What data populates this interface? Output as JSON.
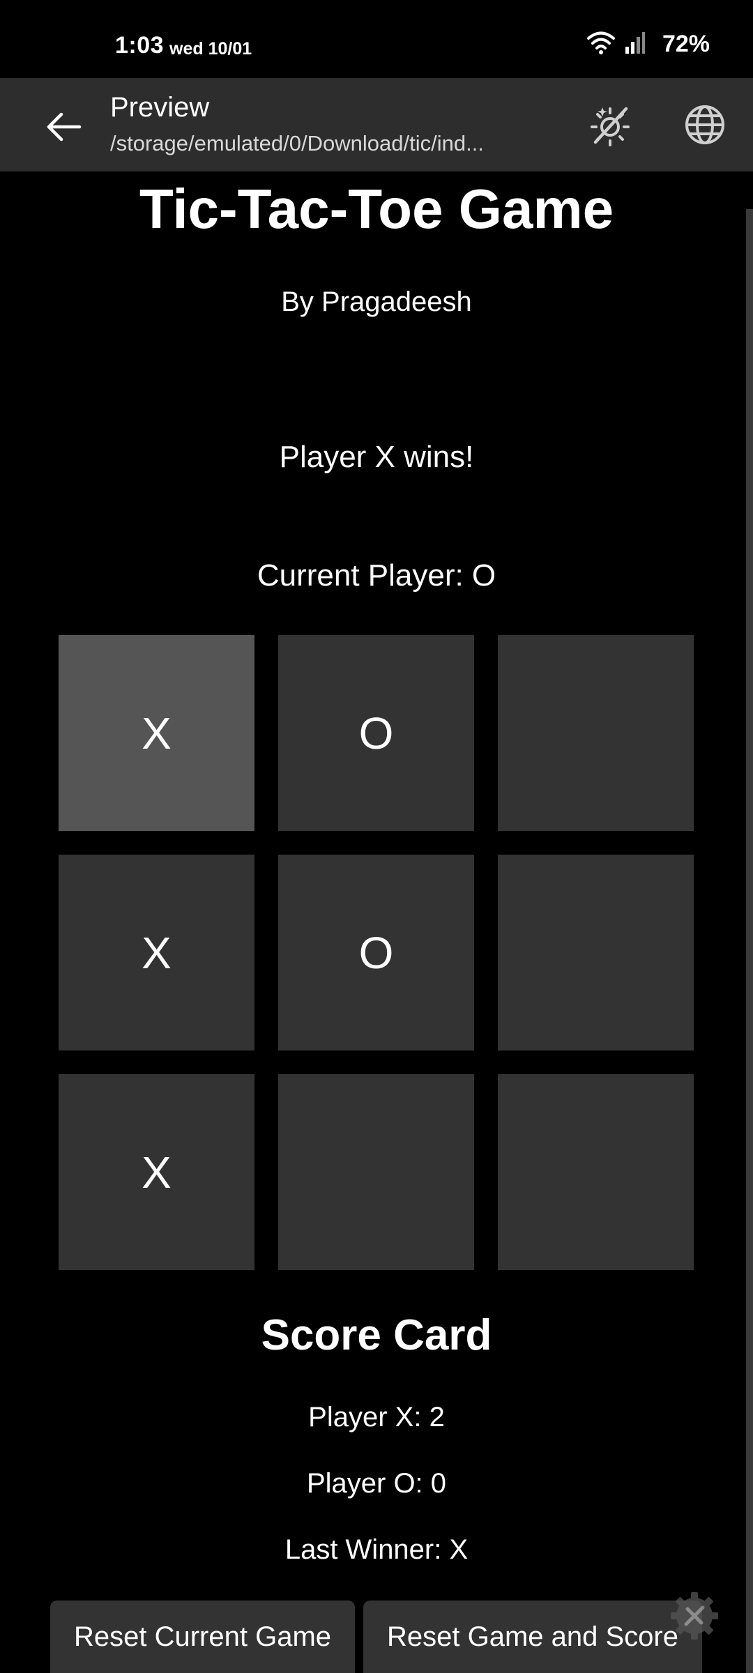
{
  "status_bar": {
    "time": "1:03",
    "date": "wed 10/01",
    "battery": "72%"
  },
  "app_bar": {
    "title": "Preview",
    "subtitle": "/storage/emulated/0/Download/tic/ind...",
    "back_icon": "arrow-left-icon",
    "theme_icon": "theme-toggle-icon",
    "globe_icon": "globe-icon"
  },
  "game": {
    "title": "Tic-Tac-Toe Game",
    "byline": "By Pragadeesh",
    "result_message": "Player X wins!",
    "current_player": "Current Player: O",
    "board": [
      [
        "X",
        "O",
        ""
      ],
      [
        "X",
        "O",
        ""
      ],
      [
        "X",
        "",
        ""
      ]
    ]
  },
  "score_card": {
    "title": "Score Card",
    "player_x": "Player X: 2",
    "player_o": "Player O: 0",
    "last_winner": "Last Winner: X"
  },
  "buttons": {
    "reset_current": "Reset Current Game",
    "reset_all": "Reset Game and Score"
  },
  "colors": {
    "background": "#000000",
    "app_bar": "#2d2d2d",
    "cell": "#333333",
    "cell_highlight": "#555555",
    "text": "#ffffff"
  }
}
